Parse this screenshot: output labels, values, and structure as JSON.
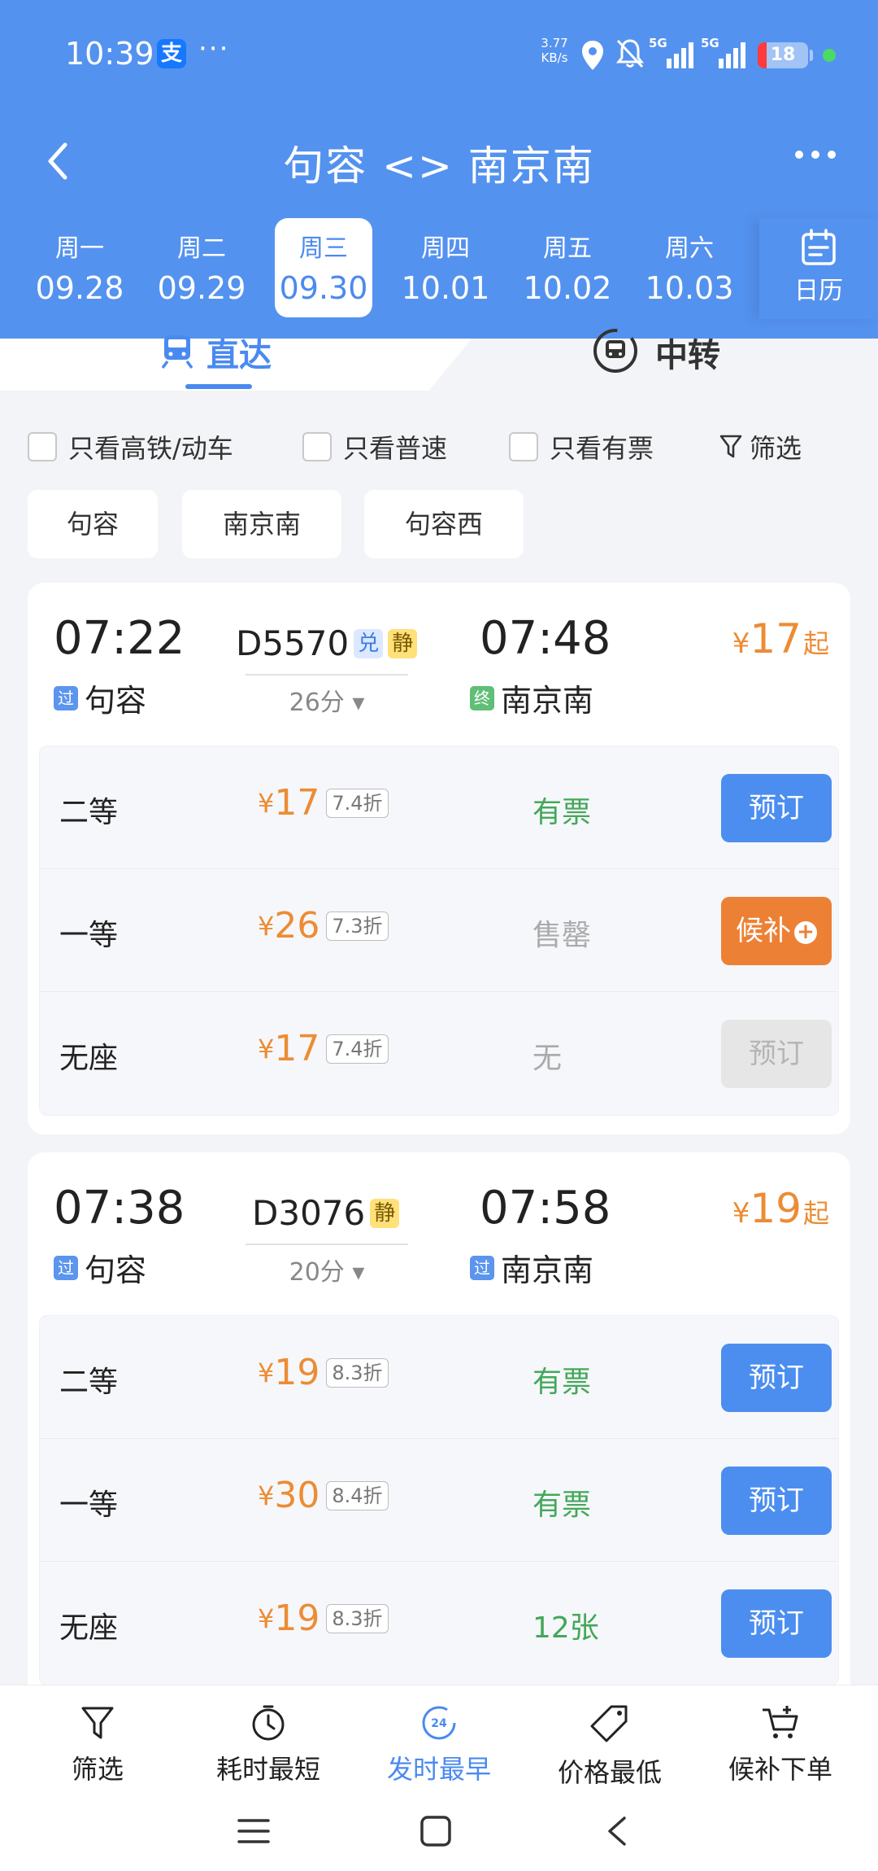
{
  "status_bar": {
    "time": "10:39",
    "alipay_glyph": "支",
    "dots": "···",
    "net_speed_value": "3.77",
    "net_speed_unit": "KB/s",
    "network_1": "5G",
    "network_2": "5G",
    "battery": "18",
    "battery_level_percent": 18
  },
  "nav": {
    "title": "句容 <> 南京南"
  },
  "dates": [
    {
      "weekday": "周一",
      "date": "09.28"
    },
    {
      "weekday": "周二",
      "date": "09.29"
    },
    {
      "weekday": "周三",
      "date": "09.30",
      "active": true
    },
    {
      "weekday": "周四",
      "date": "10.01"
    },
    {
      "weekday": "周五",
      "date": "10.02"
    },
    {
      "weekday": "周六",
      "date": "10.03"
    }
  ],
  "calendar_label": "日历",
  "tabs": {
    "direct": "直达",
    "transfer": "中转"
  },
  "filters": {
    "high_speed": "只看高铁/动车",
    "normal": "只看普速",
    "available": "只看有票",
    "more": "筛选"
  },
  "stations": [
    "句容",
    "南京南",
    "句容西"
  ],
  "trains": [
    {
      "number": "D5570",
      "badges": [
        "兑",
        "静"
      ],
      "departure_time": "07:22",
      "arrival_time": "07:48",
      "departure_tag": "过",
      "arrival_tag": "终",
      "departure_station": "句容",
      "arrival_station": "南京南",
      "duration": "26分 ▾",
      "price_from": {
        "yen": "¥",
        "amount": "17",
        "suffix": "起"
      },
      "seats": [
        {
          "class": "二等",
          "yen": "¥",
          "price": "17",
          "discount": "7.4折",
          "availability": "有票",
          "action": "预订"
        },
        {
          "class": "一等",
          "yen": "¥",
          "price": "26",
          "discount": "7.3折",
          "availability": "售罄",
          "action": "候补"
        },
        {
          "class": "无座",
          "yen": "¥",
          "price": "17",
          "discount": "7.4折",
          "availability": "无",
          "action": "预订"
        }
      ]
    },
    {
      "number": "D3076",
      "badges": [
        "静"
      ],
      "departure_time": "07:38",
      "arrival_time": "07:58",
      "departure_tag": "过",
      "arrival_tag": "过",
      "departure_station": "句容",
      "arrival_station": "南京南",
      "duration": "20分 ▾",
      "price_from": {
        "yen": "¥",
        "amount": "19",
        "suffix": "起"
      },
      "seats": [
        {
          "class": "二等",
          "yen": "¥",
          "price": "19",
          "discount": "8.3折",
          "availability": "有票",
          "action": "预订"
        },
        {
          "class": "一等",
          "yen": "¥",
          "price": "30",
          "discount": "8.4折",
          "availability": "有票",
          "action": "预订"
        },
        {
          "class": "无座",
          "yen": "¥",
          "price": "19",
          "discount": "8.3折",
          "availability": "12张",
          "action": "预订"
        }
      ]
    }
  ],
  "bottom_bar": {
    "filter": "筛选",
    "shortest": "耗时最短",
    "earliest": "发时最早",
    "earliest_icon_text": "24",
    "cheapest": "价格最低",
    "waitlist": "候补下单"
  },
  "colors": {
    "brand_blue": "#5492ef",
    "price_orange": "#ec8c35",
    "available_green": "#43a85a",
    "waitlist_orange": "#ec8135"
  }
}
